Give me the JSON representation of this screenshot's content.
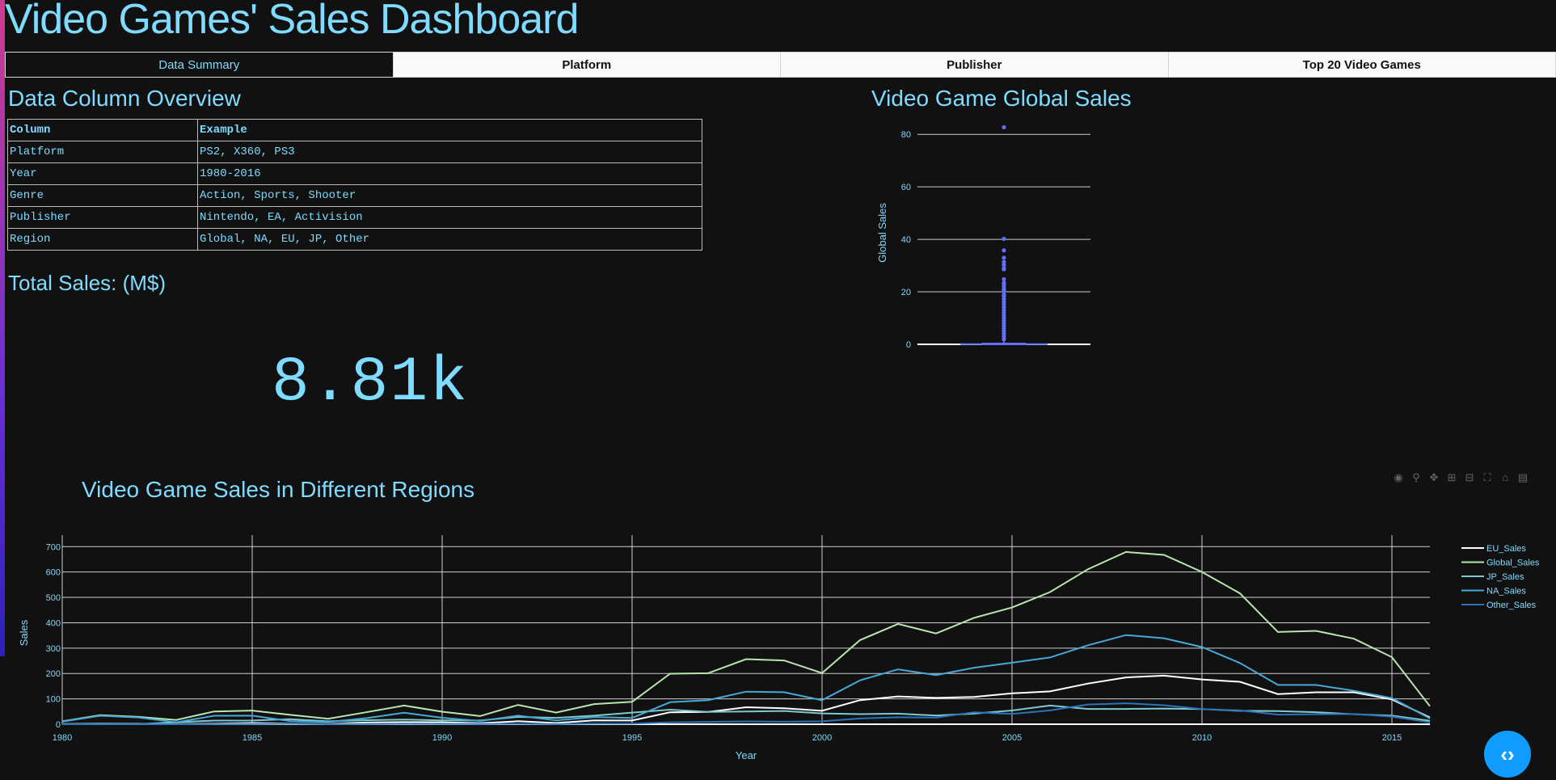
{
  "title": "Video Games' Sales Dashboard",
  "tabs": [
    {
      "label": "Data Summary",
      "active": true
    },
    {
      "label": "Platform",
      "active": false
    },
    {
      "label": "Publisher",
      "active": false
    },
    {
      "label": "Top 20 Video Games",
      "active": false
    }
  ],
  "overview": {
    "heading": "Data Column Overview",
    "headers": [
      "Column",
      "Example"
    ],
    "rows": [
      [
        "Platform",
        "PS2, X360, PS3"
      ],
      [
        "Year",
        "1980-2016"
      ],
      [
        "Genre",
        "Action, Sports, Shooter"
      ],
      [
        "Publisher",
        "Nintendo, EA, Activision"
      ],
      [
        "Region",
        "Global, NA, EU, JP, Other"
      ]
    ]
  },
  "total": {
    "label": "Total Sales: (M$)",
    "value": "8.81k"
  },
  "box_chart": {
    "title": "Video Game Global Sales"
  },
  "line_chart": {
    "title": "Video Game Sales in Different Regions"
  },
  "colors": {
    "accent_text": "#7FDBFF",
    "box": "#636EFA",
    "fab": "#119DFF"
  },
  "chart_data": [
    {
      "type": "box",
      "title": "Video Game Global Sales",
      "ylabel": "Global Sales",
      "ylim": [
        0,
        85
      ],
      "yticks": [
        0,
        20,
        40,
        60,
        80
      ],
      "box": {
        "min": 0.01,
        "q1": 0.06,
        "median": 0.17,
        "q3": 0.47,
        "upper_fence": 1.1
      },
      "outliers": [
        82.7,
        40.2,
        35.8,
        33.0,
        31.4,
        30.3,
        29.0,
        28.6,
        24.8,
        23.4,
        23.0,
        22.0,
        21.0,
        20.8,
        20.2,
        19.0,
        18.4,
        17.3,
        16.2,
        15.3,
        14.2,
        13.1,
        12.0,
        11.0,
        10.0,
        9.0,
        8.0,
        7.0,
        6.0,
        5.0,
        4.0,
        3.0,
        2.0
      ]
    },
    {
      "type": "line",
      "title": "Video Game Sales in Different Regions",
      "xlabel": "Year",
      "ylabel": "Sales",
      "xlim": [
        1980,
        2016
      ],
      "ylim": [
        0,
        720
      ],
      "xticks": [
        1980,
        1985,
        1990,
        1995,
        2000,
        2005,
        2010,
        2015
      ],
      "yticks": [
        0,
        100,
        200,
        300,
        400,
        500,
        600,
        700
      ],
      "legend_position": "right",
      "x": [
        1980,
        1981,
        1982,
        1983,
        1984,
        1985,
        1986,
        1987,
        1988,
        1989,
        1990,
        1991,
        1992,
        1993,
        1994,
        1995,
        1996,
        1997,
        1998,
        1999,
        2000,
        2001,
        2002,
        2003,
        2004,
        2005,
        2006,
        2007,
        2008,
        2009,
        2010,
        2011,
        2012,
        2013,
        2014,
        2015,
        2016
      ],
      "series": [
        {
          "name": "EU_Sales",
          "color": "#ffffff",
          "values": [
            0.7,
            1.9,
            1.7,
            0.8,
            2.1,
            4.7,
            3.0,
            1.4,
            6.6,
            8.4,
            7.6,
            3.9,
            11.7,
            4.7,
            14.9,
            14.8,
            47.3,
            48.3,
            66.9,
            62.7,
            52.8,
            94.9,
            109.7,
            103.8,
            107.3,
            121.6,
            129.2,
            160.2,
            184.4,
            191.6,
            176.6,
            167.4,
            118.8,
            125.8,
            125.7,
            97.7,
            26.8
          ]
        },
        {
          "name": "Global_Sales",
          "color": "#b9e6b0",
          "values": [
            11.4,
            35.8,
            28.9,
            16.8,
            50.4,
            53.9,
            37.1,
            21.7,
            47.2,
            73.5,
            49.4,
            32.2,
            76.2,
            45.9,
            79.2,
            88.1,
            199.2,
            200.9,
            256.5,
            251.3,
            201.6,
            331.5,
            395.5,
            357.9,
            419.3,
            459.9,
            521.0,
            611.1,
            678.9,
            667.3,
            600.3,
            515.8,
            363.5,
            368.1,
            337.1,
            264.4,
            70.9
          ]
        },
        {
          "name": "JP_Sales",
          "color": "#7fc8cf",
          "values": [
            0,
            0,
            0,
            8.1,
            14.3,
            14.6,
            19.8,
            11.6,
            15.8,
            18.4,
            14.9,
            14.8,
            28.9,
            25.3,
            33.9,
            45.8,
            57.4,
            48.9,
            50.0,
            52.3,
            42.8,
            39.9,
            41.8,
            34.2,
            41.7,
            54.3,
            73.7,
            60.3,
            60.3,
            61.9,
            59.5,
            53.0,
            51.8,
            47.6,
            39.5,
            33.7,
            13.7
          ]
        },
        {
          "name": "NA_Sales",
          "color": "#47a8d6",
          "values": [
            10.6,
            33.4,
            26.9,
            7.8,
            33.3,
            33.7,
            12.5,
            8.5,
            23.9,
            45.2,
            25.5,
            12.8,
            33.9,
            15.1,
            28.2,
            24.8,
            86.8,
            94.8,
            128.4,
            126.1,
            94.5,
            173.1,
            216.2,
            193.6,
            222.6,
            242.6,
            263.1,
            311.2,
            351.4,
            338.9,
            304.2,
            241.2,
            154.9,
            154.8,
            131.9,
            102.8,
            22.7
          ]
        },
        {
          "name": "Other_Sales",
          "color": "#2a73b8",
          "values": [
            0.1,
            0.3,
            0.3,
            0.1,
            0.7,
            0.9,
            1.9,
            0.2,
            0.99,
            1.5,
            1.4,
            0.7,
            1.7,
            0.4,
            2.2,
            2.6,
            7.7,
            9.1,
            11.1,
            10.0,
            11.6,
            22.7,
            27.3,
            26.0,
            47.3,
            40.6,
            54.5,
            77.6,
            82.4,
            74.8,
            59.9,
            54.4,
            37.8,
            39.5,
            40.0,
            30.0,
            7.8
          ]
        }
      ]
    }
  ]
}
